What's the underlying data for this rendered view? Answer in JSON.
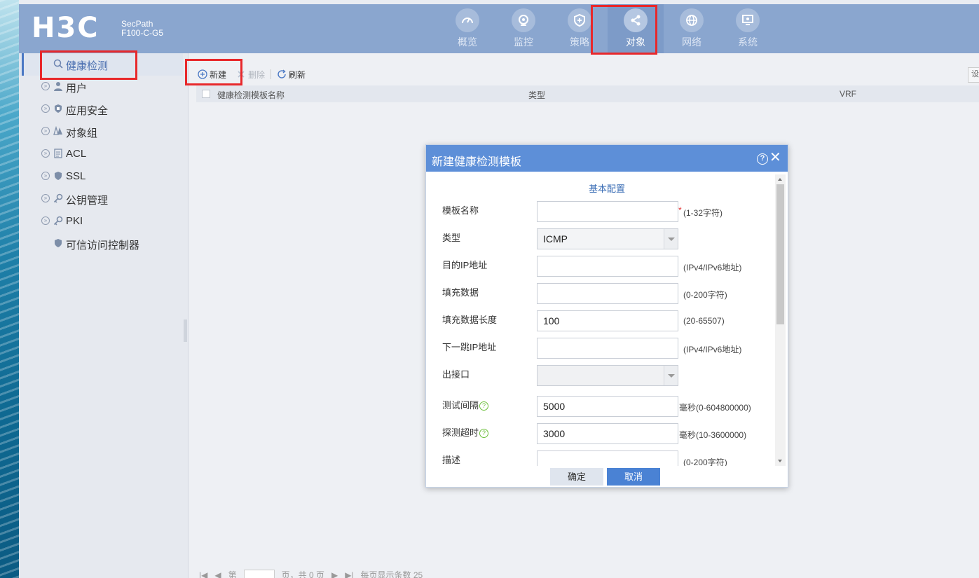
{
  "header": {
    "logo": "H3C",
    "product_line1": "SecPath",
    "product_line2": "F100-C-G5",
    "nav": [
      {
        "label": "概览",
        "icon": "gauge-icon"
      },
      {
        "label": "监控",
        "icon": "camera-icon"
      },
      {
        "label": "策略",
        "icon": "shield-icon"
      },
      {
        "label": "对象",
        "icon": "share-icon",
        "active": true
      },
      {
        "label": "网络",
        "icon": "globe-icon"
      },
      {
        "label": "系统",
        "icon": "monitor-icon"
      }
    ]
  },
  "sidebar": {
    "items": [
      {
        "label": "健康检测",
        "active": true
      },
      {
        "label": "用户"
      },
      {
        "label": "应用安全"
      },
      {
        "label": "对象组"
      },
      {
        "label": "ACL"
      },
      {
        "label": "SSL"
      },
      {
        "label": "公钥管理"
      },
      {
        "label": "PKI"
      },
      {
        "label": "可信访问控制器"
      }
    ]
  },
  "toolbar": {
    "new_label": "新建",
    "delete_label": "删除",
    "refresh_label": "刷新",
    "right_button": "设"
  },
  "grid": {
    "columns": [
      "健康检测模板名称",
      "类型",
      "VRF"
    ]
  },
  "pager": {
    "text_page": "第",
    "text_total": "页，共 0 页",
    "text_per_page": "每页显示条数 25"
  },
  "dialog": {
    "title": "新建健康检测模板",
    "section": "基本配置",
    "fields": {
      "name": {
        "label": "模板名称",
        "value": "",
        "required": "*",
        "hint": "(1-32字符)"
      },
      "type": {
        "label": "类型",
        "value": "ICMP"
      },
      "dest_ip": {
        "label": "目的IP地址",
        "value": "",
        "hint": "(IPv4/IPv6地址)"
      },
      "fill_data": {
        "label": "填充数据",
        "value": "",
        "hint": "(0-200字符)"
      },
      "fill_len": {
        "label": "填充数据长度",
        "value": "100",
        "hint": "(20-65507)"
      },
      "next_hop": {
        "label": "下一跳IP地址",
        "value": "",
        "hint": "(IPv4/IPv6地址)"
      },
      "out_if": {
        "label": "出接口",
        "value": ""
      },
      "interval": {
        "label": "测试间隔",
        "value": "5000",
        "unit": "毫秒",
        "hint": "(0-604800000)"
      },
      "timeout": {
        "label": "探测超时",
        "value": "3000",
        "unit": "毫秒",
        "hint": "(10-3600000)"
      },
      "desc": {
        "label": "描述",
        "value": "",
        "hint": "(0-200字符)"
      }
    },
    "ok_label": "确定",
    "cancel_label": "取消"
  },
  "colors": {
    "header_bg": "#8aa6cf",
    "dialog_title_bg": "#5d8fd8",
    "highlight_border": "#e8282b",
    "primary_button": "#4a82d4"
  }
}
